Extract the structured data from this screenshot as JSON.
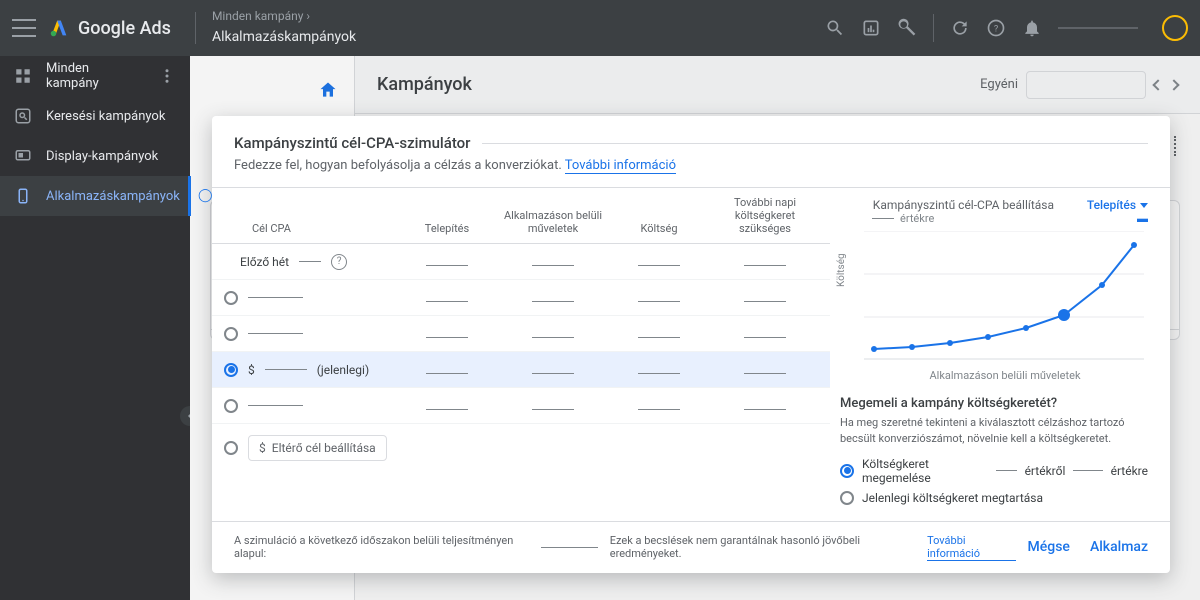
{
  "header": {
    "product": "Google Ads",
    "breadcrumb_parent": "Minden kampány ›",
    "breadcrumb_current": "Alkalmazáskampányok"
  },
  "sidebar": {
    "items": [
      {
        "label": "Minden kampány"
      },
      {
        "label": "Keresési kampányok"
      },
      {
        "label": "Display-kampányok"
      },
      {
        "label": "Alkalmazáskampányok"
      }
    ]
  },
  "page": {
    "title": "Kampányok",
    "range_label": "Egyéni"
  },
  "modal": {
    "title": "Kampányszintű cél-CPA-szimulátor",
    "subtitle_lead": "Fedezze fel, hogyan befolyásolja a célzás a konverziókat. ",
    "subtitle_link": "További információ",
    "columns": {
      "c1": "Cél CPA",
      "c2": "Telepítés",
      "c3": "Alkalmazáson belüli műveletek",
      "c4": "Költség",
      "c5": "További napi költségkeret szükséges"
    },
    "prev_week_label": "Előző hét",
    "current_label": "(jelenlegi)",
    "currency": "$",
    "custom_target_label": "Eltérő cél beállítása",
    "chart": {
      "title": "Kampányszintű cél-CPA beállítása",
      "sub": "értékre",
      "dropdown": "Telepítés",
      "ylabel": "Költség",
      "xlabel": "Alkalmazáson belüli műveletek"
    },
    "budget": {
      "heading": "Megemeli a kampány költségkeretét?",
      "desc": "Ha meg szeretné tekinteni a kiválasztott célzáshoz tartozó becsült konverziószámot, növelnie kell a költségkeretet.",
      "opt1_a": "Költségkeret megemelése",
      "opt1_b": "értékről",
      "opt1_c": "értékre",
      "opt2": "Jelenlegi költségkeret megtartása"
    },
    "footer": {
      "text1": "A szimuláció a következő időszakon belüli teljesítményen alapul:",
      "text2": "Ezek a becslések nem garantálnak hasonló jövőbeli eredményeket.",
      "link": "További információ",
      "cancel": "Mégse",
      "apply": "Alkalmaz"
    }
  },
  "chart_data": {
    "type": "line",
    "x": [
      0,
      1,
      2,
      3,
      4,
      5,
      6,
      7
    ],
    "values": [
      12,
      14,
      18,
      24,
      33,
      46,
      70,
      110
    ],
    "highlight_index": 5,
    "ylim": [
      0,
      120
    ]
  }
}
